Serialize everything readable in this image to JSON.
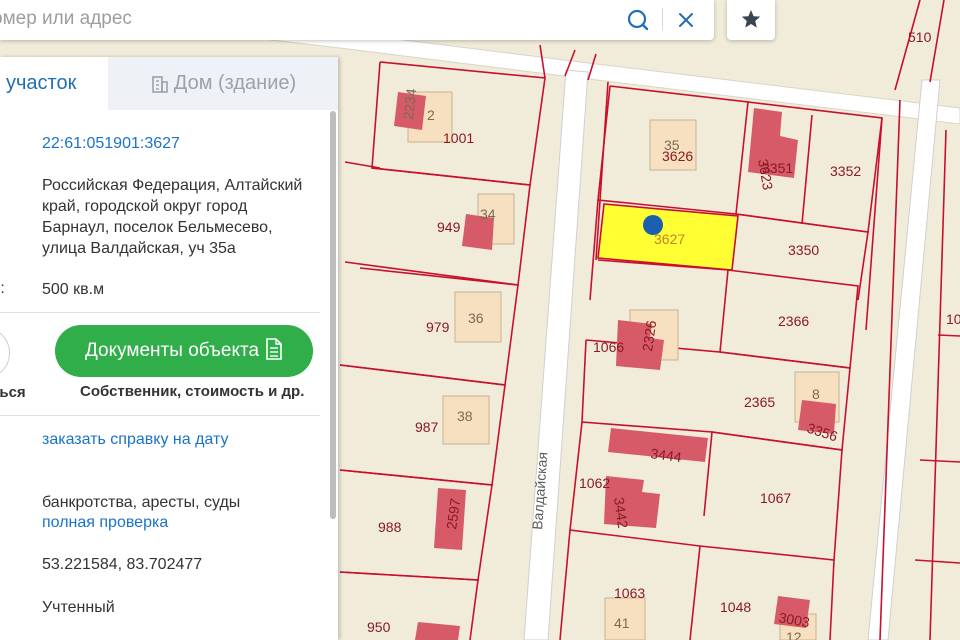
{
  "search": {
    "placeholder": "омер или адрес"
  },
  "tabs": {
    "parcel": "участок",
    "building": "Дом (здание)"
  },
  "parcel": {
    "cadastral_number": "22:61:051901:3627",
    "address": [
      "Российская Федерация, Алтайский",
      "край, городской округ город",
      "Барнаул, поселок Бельмесево,",
      "улица Валдайская, уч 35а"
    ],
    "area_label": "ь:",
    "area": "500 кв.м",
    "documents_button": "Документы объекта",
    "documents_sub": "Собственник, стоимость и др.",
    "circle_label": "ться",
    "order_link": "заказать справку на дату",
    "check_text": "банкротства, аресты, суды",
    "check_link": "полная проверка",
    "coordinates": "53.221584, 83.702477",
    "status": "Учтенный"
  },
  "map": {
    "street": "Валдайская",
    "plots": [
      "510",
      "1001",
      "949",
      "979",
      "987",
      "988",
      "950",
      "3626",
      "3627",
      "3351",
      "3352",
      "3350",
      "2366",
      "1066",
      "2365",
      "1062",
      "1067",
      "1063",
      "1048",
      "10"
    ],
    "buildings": [
      "2234",
      "2",
      "34",
      "36",
      "38",
      "2597",
      "35",
      "3623",
      "2326",
      "8",
      "3356",
      "3444",
      "3442",
      "41",
      "3003",
      "12"
    ],
    "colors": {
      "plot_border": "#c8102e",
      "building": "#d65a68",
      "house": "#f6e0c0",
      "selected": "#ffff33",
      "marker": "#1b5fae",
      "accent": "#1f6fb5",
      "doc_button": "#2fae4a"
    }
  }
}
